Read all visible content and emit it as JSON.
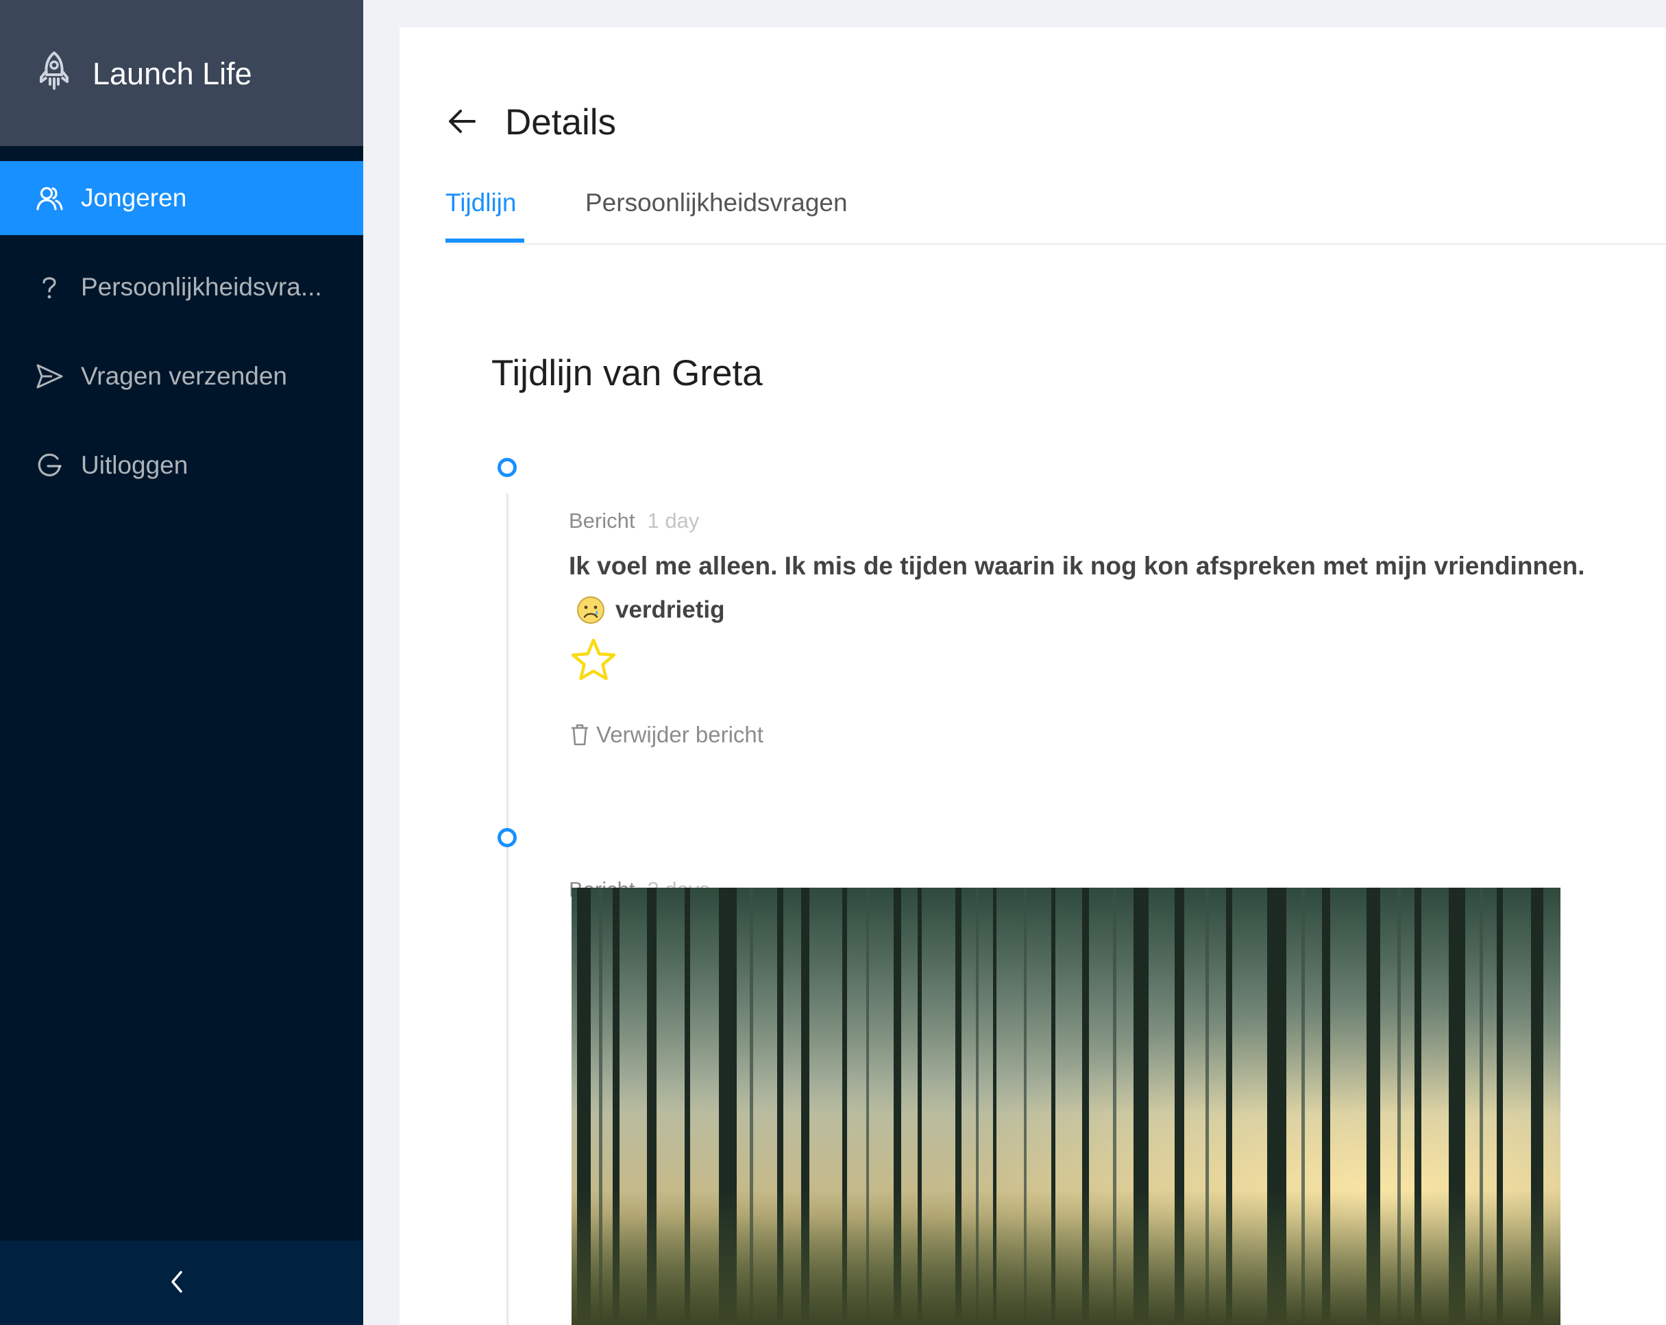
{
  "app": {
    "name": "Launch Life",
    "logo_icon": "rocket-icon"
  },
  "sidebar": {
    "items": [
      {
        "label": "Jongeren",
        "icon": "users-icon",
        "active": true
      },
      {
        "label": "Persoonlijkheidsvra...",
        "icon": "question-icon",
        "active": false
      },
      {
        "label": "Vragen verzenden",
        "icon": "send-icon",
        "active": false
      },
      {
        "label": "Uitloggen",
        "icon": "logout-icon",
        "active": false
      }
    ],
    "collapse_icon": "chevron-left-icon"
  },
  "header": {
    "title": "Details",
    "back_icon": "arrow-left-icon"
  },
  "tabs": [
    {
      "label": "Tijdlijn",
      "active": true
    },
    {
      "label": "Persoonlijkheidsvragen",
      "active": false
    }
  ],
  "timeline": {
    "title": "Tijdlijn van Greta",
    "entries": [
      {
        "kind": "Bericht",
        "ago": "1 day",
        "message": "Ik voel me alleen. Ik mis de tijden waarin ik nog kon afspreken met mijn vriendinnen.",
        "mood": {
          "emoji": "sad-face-icon",
          "label": "verdrietig"
        },
        "star_icon": "star-outline-icon",
        "delete_label": "Verwijder bericht",
        "delete_icon": "trash-icon"
      },
      {
        "kind": "Bericht",
        "ago": "2 days",
        "image": "forest-photo"
      }
    ]
  },
  "colors": {
    "sidebar_bg": "#001529",
    "logo_bg": "#3b4658",
    "accent": "#1890ff",
    "star": "#fadb14"
  }
}
